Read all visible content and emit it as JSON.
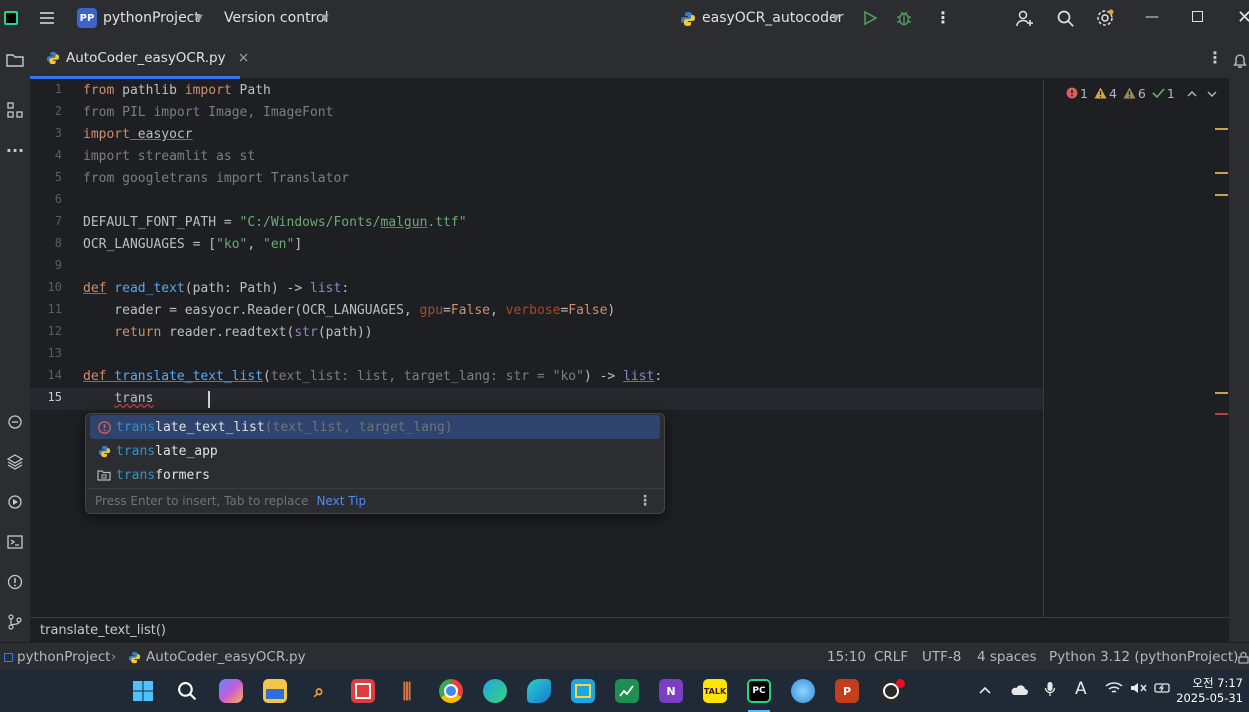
{
  "titlebar": {
    "badge": "PP",
    "project": "pythonProject",
    "vcs": "Version control",
    "run_config": "easyOCR_autocoder"
  },
  "tabs": [
    {
      "label": "AutoCoder_easyOCR.py",
      "close": "×"
    }
  ],
  "inspection": {
    "errors": "1",
    "warnings": "4",
    "weak_warnings": "6",
    "ok": "1"
  },
  "code": {
    "line_numbers": [
      "1",
      "2",
      "3",
      "4",
      "5",
      "6",
      "7",
      "8",
      "9",
      "10",
      "11",
      "12",
      "13",
      "14",
      "15"
    ],
    "l1": {
      "kw1": "from",
      "a": " pathlib ",
      "kw2": "import",
      "b": " Path"
    },
    "l2": "from PIL import Image, ImageFont",
    "l3": {
      "kw": "import",
      "b": " easyocr"
    },
    "l4": "import streamlit as st",
    "l5": "from googletrans import Translator",
    "l7": {
      "a": "DEFAULT_FONT_PATH = ",
      "s1": "\"C:/Windows/Fonts/",
      "s2": "malgun",
      "s3": ".ttf\""
    },
    "l8": {
      "a": "OCR_LANGUAGES = [",
      "s1": "\"ko\"",
      "c": ", ",
      "s2": "\"en\"",
      "b": "]"
    },
    "l10": {
      "kw": "def",
      "fn": " read_text",
      "a": "(path: Path) -> ",
      "bi": "list",
      "b": ":"
    },
    "l11": {
      "a": "    reader = easyocr.Reader(OCR_LANGUAGES, ",
      "p1": "gpu",
      "e1": "=",
      "k1": "False",
      "c": ", ",
      "p2": "verbose",
      "e2": "=",
      "k2": "False",
      "b": ")"
    },
    "l12": {
      "kw": "    return",
      "a": " reader.readtext(",
      "bi": "str",
      "b": "(path))"
    },
    "l14": {
      "kw": "def",
      "fn": " translate_text_list",
      "p": "(",
      "g": "text_list: list, target_lang: str = ",
      "s": "\"ko\"",
      "a": ") -> ",
      "bi": "list",
      "b": ":"
    },
    "l15": {
      "indent": "    ",
      "typed": "trans"
    }
  },
  "completion": {
    "items": [
      {
        "match": "trans",
        "rest": "late_text_list",
        "sig": "(text_list, target_lang)",
        "icon": "error-icon"
      },
      {
        "match": "trans",
        "rest": "late_app",
        "sig": "",
        "icon": "python-file-icon"
      },
      {
        "match": "trans",
        "rest": "formers",
        "sig": "",
        "icon": "folder-package-icon"
      }
    ],
    "footer": "Press Enter to insert, Tab to replace",
    "next_tip": "Next Tip"
  },
  "hint": "translate_text_list()",
  "statusbar": {
    "project": "pythonProject",
    "file": "AutoCoder_easyOCR.py",
    "position": "15:10",
    "line_sep": "CRLF",
    "encoding": "UTF-8",
    "indent": "4 spaces",
    "interpreter": "Python 3.12 (pythonProject)"
  },
  "taskbar": {
    "kakao_label": "TALK",
    "pycharm_label": "PC",
    "clock_time": "오전 7:17",
    "clock_date": "2025-05-31"
  },
  "colors": {
    "accent": "#3574f0",
    "error": "#bc3f3c",
    "warning": "#c9a14f"
  }
}
